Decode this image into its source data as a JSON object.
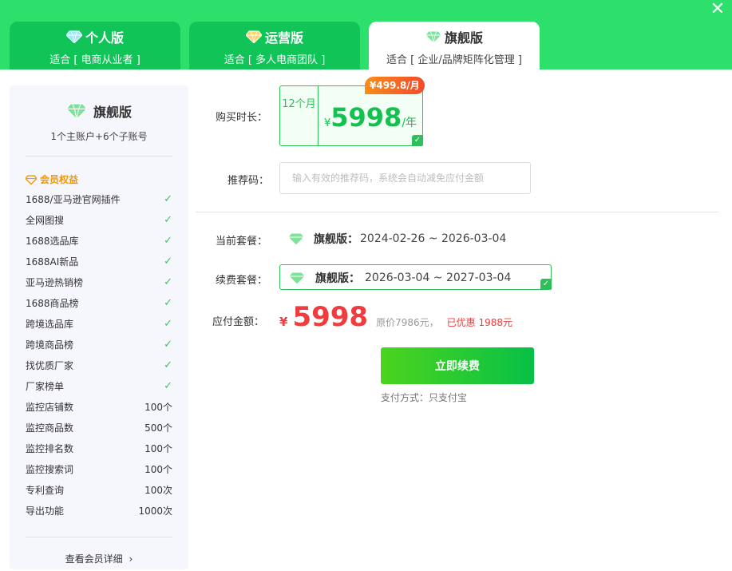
{
  "tabs": [
    {
      "title": "个人版",
      "subtitle": "适合 [ 电商从业者 ]",
      "gem_color": "#9be8ff"
    },
    {
      "title": "运营版",
      "subtitle": "适合 [ 多人电商团队 ]",
      "gem_color": "#ffd266"
    },
    {
      "title": "旗舰版",
      "subtitle": "适合 [ 企业/品牌矩阵化管理 ]",
      "gem_color": "#7ee39a"
    }
  ],
  "sidebar": {
    "title": "旗舰版",
    "subtitle": "1个主账户+6个子账号",
    "benefits_header": "会员权益",
    "check_items": [
      "1688/亚马逊官网插件",
      "全网图搜",
      "1688选品库",
      "1688AI新品",
      "亚马逊热销榜",
      "1688商品榜",
      "跨境选品库",
      "跨境商品榜",
      "找优质厂家",
      "厂家榜单"
    ],
    "quota_items": [
      {
        "label": "监控店铺数",
        "value": "100个"
      },
      {
        "label": "监控商品数",
        "value": "500个"
      },
      {
        "label": "监控排名数",
        "value": "100个"
      },
      {
        "label": "监控搜索词",
        "value": "100个"
      },
      {
        "label": "专利查询",
        "value": "100次"
      },
      {
        "label": "导出功能",
        "value": "1000次"
      }
    ],
    "detail_link": "查看会员详细"
  },
  "form": {
    "duration_label": "购买时长：",
    "plan": {
      "months": "12个月",
      "currency": "¥",
      "price": "5998",
      "unit": "/年",
      "monthly": "¥499.8/月"
    },
    "referral_label": "推荐码：",
    "referral_placeholder": "输入有效的推荐码，系统会自动减免应付金额",
    "current_label": "当前套餐：",
    "current_name": "旗舰版：",
    "current_dates": "2024-02-26 ~ 2026-03-04",
    "renew_label": "续费套餐：",
    "renew_name": "旗舰版：",
    "renew_dates": "2026-03-04 ~ 2027-03-04",
    "amount_label": "应付金额：",
    "amount_currency": "¥",
    "amount": "5998",
    "original_price": "原价7986元，",
    "discount": "已优惠 1988元",
    "button": "立即续费",
    "pay_method": "支付方式：只支付宝"
  },
  "colors": {
    "brand": "#2de06b",
    "accent": "#13c14e",
    "price_red": "#f03c3c",
    "badge_orange": "#fb8d17"
  }
}
